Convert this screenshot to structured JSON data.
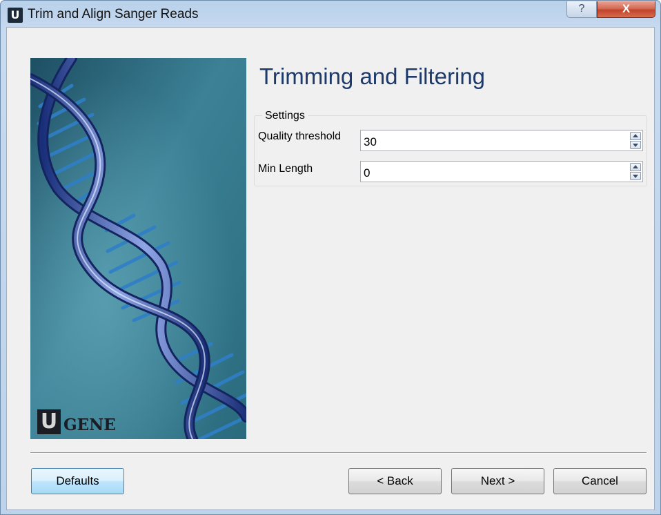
{
  "window": {
    "title": "Trim and Align Sanger Reads",
    "app_icon_letter": "U",
    "help_glyph": "?",
    "close_glyph": "X"
  },
  "page": {
    "title": "Trimming and Filtering"
  },
  "settings": {
    "group_title": "Settings",
    "fields": [
      {
        "label": "Quality threshold",
        "value": "30"
      },
      {
        "label": "Min Length",
        "value": "0"
      }
    ]
  },
  "logo": {
    "letter": "U",
    "text": "GENE"
  },
  "buttons": {
    "defaults": "Defaults",
    "back": "< Back",
    "next": "Next >",
    "cancel": "Cancel"
  },
  "colors": {
    "title_text": "#1d3a6b",
    "image_background": "#2b6b7f",
    "dna_helix": "#2c5aa8",
    "default_button_border": "#3c7fb1"
  },
  "icons": {
    "app": "ugene-app-icon",
    "help": "question-mark-icon",
    "close": "close-icon",
    "spin_up": "arrow-up-icon",
    "spin_down": "arrow-down-icon"
  }
}
